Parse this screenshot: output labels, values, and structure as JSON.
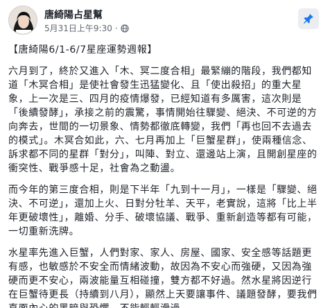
{
  "post": {
    "author": "唐綺陽占星幫",
    "date": "5月31日上午9:30",
    "title": "【唐綺陽6/1-6/7星座運勢週報】",
    "paragraphs": [
      "六月到了，終於又進入「木、冥二度合相」最緊繃的階段，我們都知道「木冥合相」是使社會發生迅猛變化、且「使出殺招」的重大星象，上一次是三、四月的疫情爆發，已經知道有多厲害，這次則是「後續發酵」，承接之前的震驚，事情開始往驟變、絕決、不可逆的方向奔去，世間的一切景象、情勢都徹底轉變，我們「再也回不去過去的模式」。木冥合如此，六、七月再加上「巨蟹星群」，使兩種信念、訴求都不同的星群「對分」，叫陣、對立、還邊站上演，且開創星座的衝突性、戰爭感十足，社會為之動盪。",
      "而今年的第三度合相，則是下半年「九到十一月」，一樣是「驟變、絕決、不可逆」，還加上火、日對分牡羊、天平，老實說，這將「比上半年更破壞性」，離婚、分手、破壞協議、戰爭、重新創造等都有可能，一切重新洗牌。",
      "水星率先進入巨蟹，人們對家、家人、房屋、國家、安全感等話題更有感，也敏感於不安全而情緒波動，故因為不安心而強硬，又因為強硬而更不安心，兩波能量互相碰撞，雙方都不好過。然水星將因逆行在巨蟹待更長（持續到八月），顯然上天要讓事件、議題發酵，要我們直面內心的黑暗與恐懼、不能輕輕滑過。"
    ]
  },
  "icons": {
    "avatar": "avatar-photo",
    "globe": "globe-icon",
    "pin": "pin-icon"
  },
  "colors": {
    "accent": "#1877f2",
    "text": "#1d2129",
    "meta": "#606770"
  }
}
